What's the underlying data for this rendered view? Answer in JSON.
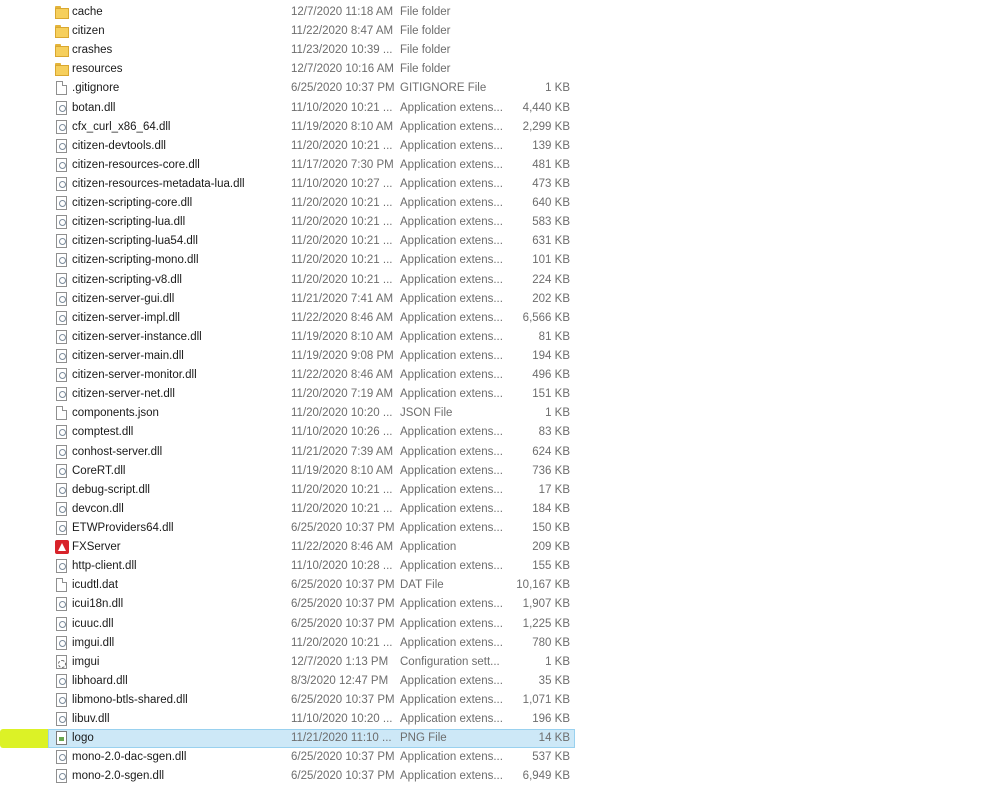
{
  "files": [
    {
      "name": "cache",
      "date": "12/7/2020 11:18 AM",
      "type": "File folder",
      "size": "",
      "icon": "folder-icon"
    },
    {
      "name": "citizen",
      "date": "11/22/2020 8:47 AM",
      "type": "File folder",
      "size": "",
      "icon": "folder-icon"
    },
    {
      "name": "crashes",
      "date": "11/23/2020 10:39 ...",
      "type": "File folder",
      "size": "",
      "icon": "folder-icon"
    },
    {
      "name": "resources",
      "date": "12/7/2020 10:16 AM",
      "type": "File folder",
      "size": "",
      "icon": "folder-icon"
    },
    {
      "name": ".gitignore",
      "date": "6/25/2020 10:37 PM",
      "type": "GITIGNORE File",
      "size": "1 KB",
      "icon": "file-icon"
    },
    {
      "name": "botan.dll",
      "date": "11/10/2020 10:21 ...",
      "type": "Application extens...",
      "size": "4,440 KB",
      "icon": "dll-icon"
    },
    {
      "name": "cfx_curl_x86_64.dll",
      "date": "11/19/2020 8:10 AM",
      "type": "Application extens...",
      "size": "2,299 KB",
      "icon": "dll-icon"
    },
    {
      "name": "citizen-devtools.dll",
      "date": "11/20/2020 10:21 ...",
      "type": "Application extens...",
      "size": "139 KB",
      "icon": "dll-icon"
    },
    {
      "name": "citizen-resources-core.dll",
      "date": "11/17/2020 7:30 PM",
      "type": "Application extens...",
      "size": "481 KB",
      "icon": "dll-icon"
    },
    {
      "name": "citizen-resources-metadata-lua.dll",
      "date": "11/10/2020 10:27 ...",
      "type": "Application extens...",
      "size": "473 KB",
      "icon": "dll-icon"
    },
    {
      "name": "citizen-scripting-core.dll",
      "date": "11/20/2020 10:21 ...",
      "type": "Application extens...",
      "size": "640 KB",
      "icon": "dll-icon"
    },
    {
      "name": "citizen-scripting-lua.dll",
      "date": "11/20/2020 10:21 ...",
      "type": "Application extens...",
      "size": "583 KB",
      "icon": "dll-icon"
    },
    {
      "name": "citizen-scripting-lua54.dll",
      "date": "11/20/2020 10:21 ...",
      "type": "Application extens...",
      "size": "631 KB",
      "icon": "dll-icon"
    },
    {
      "name": "citizen-scripting-mono.dll",
      "date": "11/20/2020 10:21 ...",
      "type": "Application extens...",
      "size": "101 KB",
      "icon": "dll-icon"
    },
    {
      "name": "citizen-scripting-v8.dll",
      "date": "11/20/2020 10:21 ...",
      "type": "Application extens...",
      "size": "224 KB",
      "icon": "dll-icon"
    },
    {
      "name": "citizen-server-gui.dll",
      "date": "11/21/2020 7:41 AM",
      "type": "Application extens...",
      "size": "202 KB",
      "icon": "dll-icon"
    },
    {
      "name": "citizen-server-impl.dll",
      "date": "11/22/2020 8:46 AM",
      "type": "Application extens...",
      "size": "6,566 KB",
      "icon": "dll-icon"
    },
    {
      "name": "citizen-server-instance.dll",
      "date": "11/19/2020 8:10 AM",
      "type": "Application extens...",
      "size": "81 KB",
      "icon": "dll-icon"
    },
    {
      "name": "citizen-server-main.dll",
      "date": "11/19/2020 9:08 PM",
      "type": "Application extens...",
      "size": "194 KB",
      "icon": "dll-icon"
    },
    {
      "name": "citizen-server-monitor.dll",
      "date": "11/22/2020 8:46 AM",
      "type": "Application extens...",
      "size": "496 KB",
      "icon": "dll-icon"
    },
    {
      "name": "citizen-server-net.dll",
      "date": "11/20/2020 7:19 AM",
      "type": "Application extens...",
      "size": "151 KB",
      "icon": "dll-icon"
    },
    {
      "name": "components.json",
      "date": "11/20/2020 10:20 ...",
      "type": "JSON File",
      "size": "1 KB",
      "icon": "file-icon"
    },
    {
      "name": "comptest.dll",
      "date": "11/10/2020 10:26 ...",
      "type": "Application extens...",
      "size": "83 KB",
      "icon": "dll-icon"
    },
    {
      "name": "conhost-server.dll",
      "date": "11/21/2020 7:39 AM",
      "type": "Application extens...",
      "size": "624 KB",
      "icon": "dll-icon"
    },
    {
      "name": "CoreRT.dll",
      "date": "11/19/2020 8:10 AM",
      "type": "Application extens...",
      "size": "736 KB",
      "icon": "dll-icon"
    },
    {
      "name": "debug-script.dll",
      "date": "11/20/2020 10:21 ...",
      "type": "Application extens...",
      "size": "17 KB",
      "icon": "dll-icon"
    },
    {
      "name": "devcon.dll",
      "date": "11/20/2020 10:21 ...",
      "type": "Application extens...",
      "size": "184 KB",
      "icon": "dll-icon"
    },
    {
      "name": "ETWProviders64.dll",
      "date": "6/25/2020 10:37 PM",
      "type": "Application extens...",
      "size": "150 KB",
      "icon": "dll-icon"
    },
    {
      "name": "FXServer",
      "date": "11/22/2020 8:46 AM",
      "type": "Application",
      "size": "209 KB",
      "icon": "fxserver-app-icon"
    },
    {
      "name": "http-client.dll",
      "date": "11/10/2020 10:28 ...",
      "type": "Application extens...",
      "size": "155 KB",
      "icon": "dll-icon"
    },
    {
      "name": "icudtl.dat",
      "date": "6/25/2020 10:37 PM",
      "type": "DAT File",
      "size": "10,167 KB",
      "icon": "file-icon"
    },
    {
      "name": "icui18n.dll",
      "date": "6/25/2020 10:37 PM",
      "type": "Application extens...",
      "size": "1,907 KB",
      "icon": "dll-icon"
    },
    {
      "name": "icuuc.dll",
      "date": "6/25/2020 10:37 PM",
      "type": "Application extens...",
      "size": "1,225 KB",
      "icon": "dll-icon"
    },
    {
      "name": "imgui.dll",
      "date": "11/20/2020 10:21 ...",
      "type": "Application extens...",
      "size": "780 KB",
      "icon": "dll-icon"
    },
    {
      "name": "imgui",
      "date": "12/7/2020 1:13 PM",
      "type": "Configuration sett...",
      "size": "1 KB",
      "icon": "config-icon"
    },
    {
      "name": "libhoard.dll",
      "date": "8/3/2020 12:47 PM",
      "type": "Application extens...",
      "size": "35 KB",
      "icon": "dll-icon"
    },
    {
      "name": "libmono-btls-shared.dll",
      "date": "6/25/2020 10:37 PM",
      "type": "Application extens...",
      "size": "1,071 KB",
      "icon": "dll-icon"
    },
    {
      "name": "libuv.dll",
      "date": "11/10/2020 10:20 ...",
      "type": "Application extens...",
      "size": "196 KB",
      "icon": "dll-icon"
    },
    {
      "name": "logo",
      "date": "11/21/2020 11:10 ...",
      "type": "PNG File",
      "size": "14 KB",
      "icon": "png-image-icon",
      "selected": true
    },
    {
      "name": "mono-2.0-dac-sgen.dll",
      "date": "6/25/2020 10:37 PM",
      "type": "Application extens...",
      "size": "537 KB",
      "icon": "dll-icon"
    },
    {
      "name": "mono-2.0-sgen.dll",
      "date": "6/25/2020 10:37 PM",
      "type": "Application extens...",
      "size": "6,949 KB",
      "icon": "dll-icon"
    }
  ],
  "colors": {
    "folder": "#f6cf5c",
    "selection": "#cde8f7",
    "highlighter": "#d6f000",
    "fxserver_icon": "#d8232a",
    "secondary_text": "#6d6d6d"
  }
}
